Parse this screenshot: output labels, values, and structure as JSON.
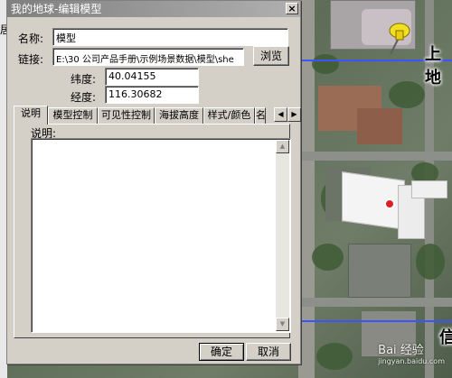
{
  "window": {
    "title": "我的地球-编辑模型",
    "close_glyph": "×"
  },
  "form": {
    "name_label": "名称:",
    "name_value": "模型",
    "link_label": "链接:",
    "link_value": "E:\\30 公司产品手册\\示例场景数据\\模型\\she",
    "browse_label": "浏览",
    "lat_label": "纬度:",
    "lat_value": "40.04155",
    "lon_label": "经度:",
    "lon_value": "116.30682"
  },
  "tabs": [
    {
      "label": "说明",
      "active": true
    },
    {
      "label": "模型控制",
      "active": false
    },
    {
      "label": "可见性控制",
      "active": false
    },
    {
      "label": "海拔高度",
      "active": false
    },
    {
      "label": "样式/颜色",
      "active": false
    },
    {
      "label": "名",
      "active": false
    }
  ],
  "panel": {
    "desc_label": "说明:"
  },
  "buttons": {
    "ok_label": "确定",
    "cancel_label": "取消"
  },
  "map": {
    "label_top": "上地",
    "label_bottom": "信",
    "left_strip_label": "居"
  },
  "watermark": {
    "brand": "Bai 经验",
    "url": "jingyan.baidu.com"
  },
  "colors": {
    "boundary_line": "#3a55ff",
    "pin": "#f0e020",
    "marker": "#e02020"
  }
}
